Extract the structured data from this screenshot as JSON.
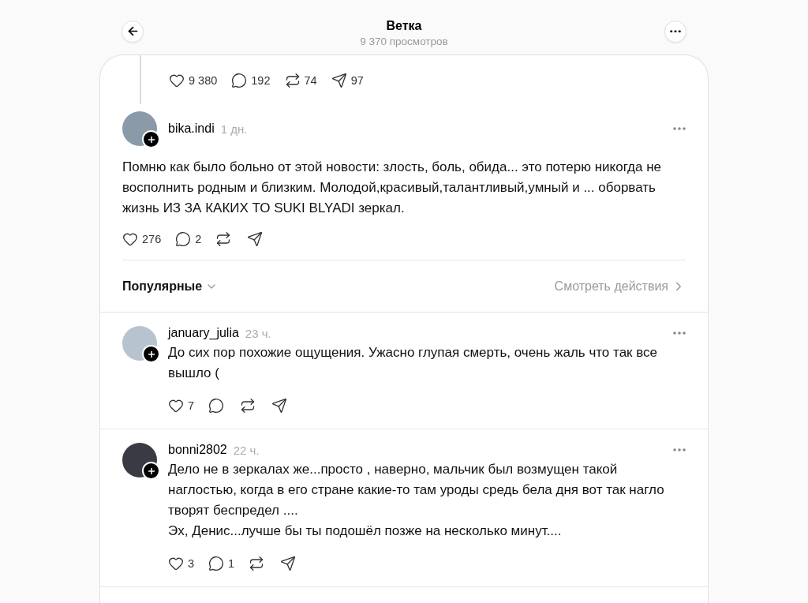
{
  "header": {
    "title": "Ветка",
    "subtitle": "9 370 просмотров"
  },
  "parent_post": {
    "actions": [
      {
        "kind": "like",
        "count": "9 380"
      },
      {
        "kind": "reply",
        "count": "192"
      },
      {
        "kind": "repost",
        "count": "74"
      },
      {
        "kind": "share",
        "count": "97"
      }
    ]
  },
  "post": {
    "author": "bika.indi",
    "time": "1 дн.",
    "text": "Помню как было больно от этой новости: злость, боль, обида... это потерю никогда не восполнить родным и близким. Молодой,красивый,талантливый,умный и ... оборвать жизнь ИЗ ЗА КАКИХ ТО SUKI BLYADI зеркал.",
    "actions": [
      {
        "kind": "like",
        "count": "276"
      },
      {
        "kind": "reply",
        "count": "2"
      },
      {
        "kind": "repost"
      },
      {
        "kind": "share"
      }
    ]
  },
  "sort": {
    "label": "Популярные",
    "activity_link": "Смотреть действия"
  },
  "replies": [
    {
      "author": "january_julia",
      "time": "23 ч.",
      "text": "До сих пор похожие ощущения. Ужасно глупая смерть, очень жаль что так все вышло (",
      "actions": [
        {
          "kind": "like",
          "count": "7"
        },
        {
          "kind": "reply"
        },
        {
          "kind": "repost"
        },
        {
          "kind": "share"
        }
      ]
    },
    {
      "author": "bonni2802",
      "time": "22 ч.",
      "text": "Дело не в зеркалах же...просто , наверно, мальчик был возмущен такой наглостью, когда в его стране какие-то там уроды средь бела дня вот так нагло творят беспредел ....\nЭх, Денис...лучше бы ты подошёл позже на несколько минут....",
      "actions": [
        {
          "kind": "like",
          "count": "3"
        },
        {
          "kind": "reply",
          "count": "1"
        },
        {
          "kind": "repost"
        },
        {
          "kind": "share"
        }
      ]
    }
  ]
}
